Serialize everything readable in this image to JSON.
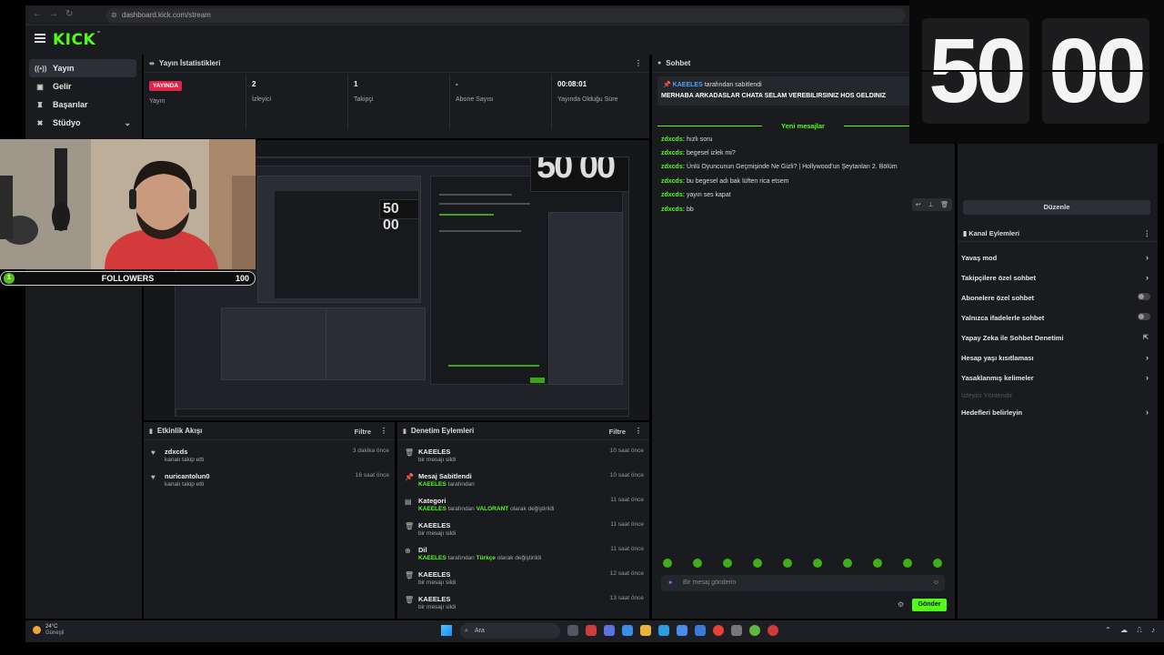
{
  "browser": {
    "url": "dashboard.kick.com/stream"
  },
  "brand": {
    "logo": "KICK",
    "accent": "#53fc18"
  },
  "sidebar": {
    "items": [
      {
        "label": "Yayın",
        "icon": "broadcast-icon"
      },
      {
        "label": "Gelir",
        "icon": "revenue-icon"
      },
      {
        "label": "Başarılar",
        "icon": "trophy-icon"
      },
      {
        "label": "Stüdyo",
        "icon": "studio-icon"
      }
    ]
  },
  "stats": {
    "title": "Yayın İstatistikleri",
    "live_badge": "YAYINDA",
    "live_label": "Yayın",
    "viewers": {
      "value": "2",
      "label": "İzleyici"
    },
    "followers": {
      "value": "1",
      "label": "Takipçi"
    },
    "subs": {
      "value": "-",
      "label": "Abone Sayısı"
    },
    "uptime": {
      "value": "00:08:01",
      "label": "Yayında Olduğu Süre"
    }
  },
  "events": {
    "title": "Etkinlik Akışı",
    "filter": "Filtre",
    "items": [
      {
        "user": "zdxcds",
        "action": "kanalı takip etti",
        "time": "3 dakika önce"
      },
      {
        "user": "nuricantolun0",
        "action": "kanalı takip etti",
        "time": "16 saat önce"
      }
    ]
  },
  "moderation": {
    "title": "Denetim Eylemleri",
    "filter": "Filtre",
    "items": [
      {
        "title": "KAEELES",
        "sub": "bir mesajı sildi",
        "time": "10 saat önce"
      },
      {
        "title": "Mesaj Sabitlendi",
        "sub_user": "KAEELES",
        "sub": "tarafından",
        "time": "10 saat önce"
      },
      {
        "title": "Kategori",
        "sub_user": "KAEELES",
        "sub": "tarafından",
        "sub_value": "VALORANT",
        "sub_end": "olarak değiştirildi",
        "time": "11 saat önce"
      },
      {
        "title": "KAEELES",
        "sub": "bir mesajı sildi",
        "time": "11 saat önce"
      },
      {
        "title": "Dil",
        "sub_user": "KAEELES",
        "sub": "tarafından",
        "sub_value": "Türkçe",
        "sub_end": "olarak değiştirildi",
        "time": "11 saat önce"
      },
      {
        "title": "KAEELES",
        "sub": "bir mesajı sildi",
        "time": "12 saat önce"
      },
      {
        "title": "KAEELES",
        "sub": "bir mesajı sildi",
        "time": "13 saat önce"
      }
    ]
  },
  "chat": {
    "title": "Sohbet",
    "pinned_user": "KAEELES",
    "pinned_by": "tarafından sabitlendi",
    "pinned_message": "MERHABA ARKADASLAR CHATA SELAM VEREBILIRSINIZ HOS GELDINIZ",
    "new_messages": "Yeni mesajlar",
    "messages": [
      {
        "user": "zdxcds:",
        "text": "hızlı soru"
      },
      {
        "user": "zdxcds:",
        "text": "begesel izlek mi?"
      },
      {
        "user": "zdxcds:",
        "text": "Ünlü Oyuncunun Geçmişinde Ne Gizli? | Hollywood'un Şeytanları 2. Bölüm"
      },
      {
        "user": "zdxcds:",
        "text": "bu begesel adı bak lüften rica etsem"
      },
      {
        "user": "zdxcds:",
        "text": "yayın ses kapat"
      },
      {
        "user": "zdxcds:",
        "text": "bb"
      }
    ],
    "input_placeholder": "Bir mesaj gönderin",
    "send_label": "Gönder"
  },
  "channel_actions": {
    "edit_label": "Düzenle",
    "title": "Kanal Eylemleri",
    "items": [
      {
        "label": "Yavaş mod",
        "control": "chevron"
      },
      {
        "label": "Takipçilere özel sohbet",
        "control": "chevron"
      },
      {
        "label": "Abonelere özel sohbet",
        "control": "toggle"
      },
      {
        "label": "Yalnızca ifadelerle sohbet",
        "control": "toggle"
      },
      {
        "label": "Yapay Zeka ile Sohbet Denetimi",
        "control": "external"
      },
      {
        "label": "Hesap yaşı kısıtlaması",
        "control": "chevron"
      },
      {
        "label": "Yasaklanmış kelimeler",
        "control": "chevron"
      },
      {
        "label": "İzleyici Yönlendir",
        "control": "none",
        "disabled": true
      },
      {
        "label": "Hedefleri belirleyin",
        "control": "chevron"
      }
    ]
  },
  "timer": {
    "minutes": "50",
    "seconds": "00"
  },
  "overlay": {
    "followers_count": "1",
    "followers_label": "FOLLOWERS",
    "followers_goal": "100"
  },
  "taskbar": {
    "temp": "24°C",
    "condition": "Güneşli",
    "search_placeholder": "Ara"
  }
}
